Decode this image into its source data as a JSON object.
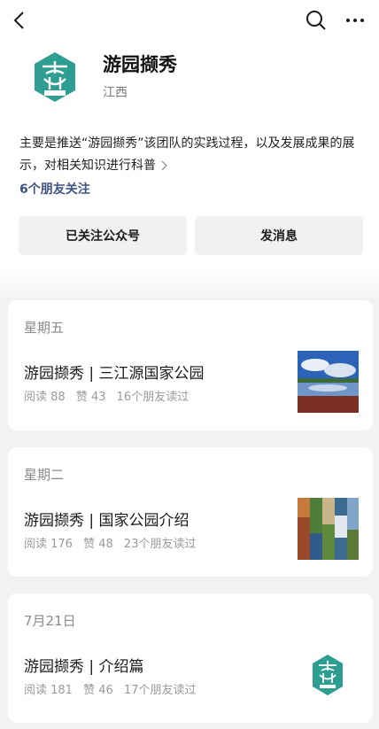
{
  "nav": {
    "back_icon": "chevron-left-icon",
    "search_icon": "search-icon",
    "more_icon": "more-dots-icon"
  },
  "account": {
    "name": "游园撷秀",
    "region": "江西",
    "description": "主要是推送“游园撷秀”该团队的实践过程，以及发展成果的展示，对相关知识进行科普",
    "friends_follow": "6个朋友关注",
    "avatar_icon": "teal-emblem-logo",
    "brand_color": "#2e9e93"
  },
  "buttons": {
    "followed": "已关注公众号",
    "message": "发消息"
  },
  "articles": [
    {
      "date": "星期五",
      "title": "游园撷秀 | 三江源国家公园",
      "reads": "阅读 88",
      "likes": "赞 43",
      "friends": "16个朋友读过",
      "thumb": "landscape-lake-photo"
    },
    {
      "date": "星期二",
      "title": "游园撷秀 | 国家公园介绍",
      "reads": "阅读 176",
      "likes": "赞 48",
      "friends": "23个朋友读过",
      "thumb": "park-collage-photo"
    },
    {
      "date": "7月21日",
      "title": "游园撷秀 | 介绍篇",
      "reads": "阅读 181",
      "likes": "赞 46",
      "friends": "17个朋友读过",
      "thumb": "teal-emblem-logo"
    }
  ]
}
